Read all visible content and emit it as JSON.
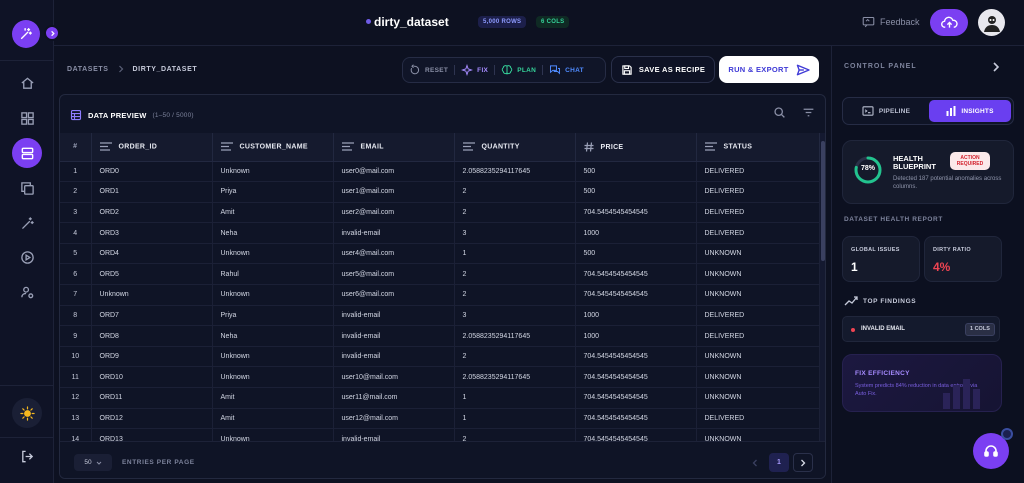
{
  "topbar": {
    "dataset_name": "dirty_dataset",
    "rows_badge": "5,000 ROWS",
    "cols_badge": "6 COLS",
    "feedback_label": "Feedback"
  },
  "breadcrumb": {
    "root": "DATASETS",
    "current": "DIRTY_DATASET"
  },
  "actions": {
    "reset": "RESET",
    "fix": "FIX",
    "plan": "PLAN",
    "chat": "CHAT",
    "save_recipe": "SAVE AS RECIPE",
    "run_export": "RUN & EXPORT"
  },
  "preview": {
    "title": "DATA PREVIEW",
    "range": "(1–50 / 5000)",
    "index_header": "#",
    "columns": [
      "ORDER_ID",
      "CUSTOMER_NAME",
      "EMAIL",
      "QUANTITY",
      "PRICE",
      "STATUS"
    ],
    "rows": [
      [
        "1",
        "ORD0",
        "Unknown",
        "user0@mail.com",
        "2.0588235294117645",
        "500",
        "DELIVERED"
      ],
      [
        "2",
        "ORD1",
        "Priya",
        "user1@mail.com",
        "2",
        "500",
        "DELIVERED"
      ],
      [
        "3",
        "ORD2",
        "Amit",
        "user2@mail.com",
        "2",
        "704.5454545454545",
        "DELIVERED"
      ],
      [
        "4",
        "ORD3",
        "Neha",
        "invalid-email",
        "3",
        "1000",
        "DELIVERED"
      ],
      [
        "5",
        "ORD4",
        "Unknown",
        "user4@mail.com",
        "1",
        "500",
        "UNKNOWN"
      ],
      [
        "6",
        "ORD5",
        "Rahul",
        "user5@mail.com",
        "2",
        "704.5454545454545",
        "UNKNOWN"
      ],
      [
        "7",
        "Unknown",
        "Unknown",
        "user6@mail.com",
        "2",
        "704.5454545454545",
        "UNKNOWN"
      ],
      [
        "8",
        "ORD7",
        "Priya",
        "invalid-email",
        "3",
        "1000",
        "DELIVERED"
      ],
      [
        "9",
        "ORD8",
        "Neha",
        "invalid-email",
        "2.0588235294117645",
        "1000",
        "DELIVERED"
      ],
      [
        "10",
        "ORD9",
        "Unknown",
        "invalid-email",
        "2",
        "704.5454545454545",
        "UNKNOWN"
      ],
      [
        "11",
        "ORD10",
        "Unknown",
        "user10@mail.com",
        "2.0588235294117645",
        "704.5454545454545",
        "UNKNOWN"
      ],
      [
        "12",
        "ORD11",
        "Amit",
        "user11@mail.com",
        "1",
        "704.5454545454545",
        "UNKNOWN"
      ],
      [
        "13",
        "ORD12",
        "Amit",
        "user12@mail.com",
        "1",
        "704.5454545454545",
        "DELIVERED"
      ],
      [
        "14",
        "ORD13",
        "Unknown",
        "invalid-email",
        "2",
        "704.5454545454545",
        "UNKNOWN"
      ]
    ],
    "per_page_value": "50",
    "per_page_label": "ENTRIES PER PAGE",
    "current_page": "1"
  },
  "panel": {
    "title": "CONTROL PANEL",
    "tab_pipeline": "PIPELINE",
    "tab_insights": "INSIGHTS",
    "blueprint_title": "HEALTH BLUEPRINT",
    "blueprint_badge": "ACTION REQUIRED",
    "blueprint_score": "78%",
    "blueprint_score_value": 78,
    "blueprint_desc": "Detected 187 potential anomalies across columns.",
    "health_report_title": "DATASET HEALTH REPORT",
    "global_issues_label": "GLOBAL ISSUES",
    "global_issues_value": "1",
    "dirty_ratio_label": "DIRTY RATIO",
    "dirty_ratio_value": "4%",
    "top_findings_title": "TOP FINDINGS",
    "finding_label": "INVALID EMAIL",
    "finding_count": "1 COLS",
    "fix_title": "FIX EFFICIENCY",
    "fix_desc": "System predicts 84% reduction in data entropy via Auto Fix."
  },
  "colors": {
    "accent": "#7b3ff2",
    "danger": "#ef4452",
    "success": "#22c38e",
    "background": "#0d1121"
  },
  "icons": {
    "rail": [
      "home-icon",
      "grid-icon",
      "database-icon",
      "copy-icon",
      "magic-wand-icon",
      "play-icon",
      "user-settings-icon"
    ],
    "theme": "sun-icon",
    "logout": "logout-icon"
  }
}
